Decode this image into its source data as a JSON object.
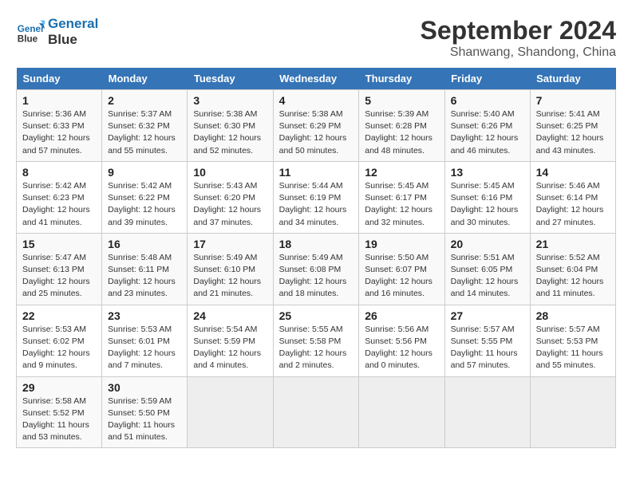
{
  "header": {
    "logo_line1": "General",
    "logo_line2": "Blue",
    "title": "September 2024",
    "subtitle": "Shanwang, Shandong, China"
  },
  "columns": [
    "Sunday",
    "Monday",
    "Tuesday",
    "Wednesday",
    "Thursday",
    "Friday",
    "Saturday"
  ],
  "weeks": [
    [
      {
        "day": "1",
        "info": "Sunrise: 5:36 AM\nSunset: 6:33 PM\nDaylight: 12 hours\nand 57 minutes."
      },
      {
        "day": "2",
        "info": "Sunrise: 5:37 AM\nSunset: 6:32 PM\nDaylight: 12 hours\nand 55 minutes."
      },
      {
        "day": "3",
        "info": "Sunrise: 5:38 AM\nSunset: 6:30 PM\nDaylight: 12 hours\nand 52 minutes."
      },
      {
        "day": "4",
        "info": "Sunrise: 5:38 AM\nSunset: 6:29 PM\nDaylight: 12 hours\nand 50 minutes."
      },
      {
        "day": "5",
        "info": "Sunrise: 5:39 AM\nSunset: 6:28 PM\nDaylight: 12 hours\nand 48 minutes."
      },
      {
        "day": "6",
        "info": "Sunrise: 5:40 AM\nSunset: 6:26 PM\nDaylight: 12 hours\nand 46 minutes."
      },
      {
        "day": "7",
        "info": "Sunrise: 5:41 AM\nSunset: 6:25 PM\nDaylight: 12 hours\nand 43 minutes."
      }
    ],
    [
      {
        "day": "8",
        "info": "Sunrise: 5:42 AM\nSunset: 6:23 PM\nDaylight: 12 hours\nand 41 minutes."
      },
      {
        "day": "9",
        "info": "Sunrise: 5:42 AM\nSunset: 6:22 PM\nDaylight: 12 hours\nand 39 minutes."
      },
      {
        "day": "10",
        "info": "Sunrise: 5:43 AM\nSunset: 6:20 PM\nDaylight: 12 hours\nand 37 minutes."
      },
      {
        "day": "11",
        "info": "Sunrise: 5:44 AM\nSunset: 6:19 PM\nDaylight: 12 hours\nand 34 minutes."
      },
      {
        "day": "12",
        "info": "Sunrise: 5:45 AM\nSunset: 6:17 PM\nDaylight: 12 hours\nand 32 minutes."
      },
      {
        "day": "13",
        "info": "Sunrise: 5:45 AM\nSunset: 6:16 PM\nDaylight: 12 hours\nand 30 minutes."
      },
      {
        "day": "14",
        "info": "Sunrise: 5:46 AM\nSunset: 6:14 PM\nDaylight: 12 hours\nand 27 minutes."
      }
    ],
    [
      {
        "day": "15",
        "info": "Sunrise: 5:47 AM\nSunset: 6:13 PM\nDaylight: 12 hours\nand 25 minutes."
      },
      {
        "day": "16",
        "info": "Sunrise: 5:48 AM\nSunset: 6:11 PM\nDaylight: 12 hours\nand 23 minutes."
      },
      {
        "day": "17",
        "info": "Sunrise: 5:49 AM\nSunset: 6:10 PM\nDaylight: 12 hours\nand 21 minutes."
      },
      {
        "day": "18",
        "info": "Sunrise: 5:49 AM\nSunset: 6:08 PM\nDaylight: 12 hours\nand 18 minutes."
      },
      {
        "day": "19",
        "info": "Sunrise: 5:50 AM\nSunset: 6:07 PM\nDaylight: 12 hours\nand 16 minutes."
      },
      {
        "day": "20",
        "info": "Sunrise: 5:51 AM\nSunset: 6:05 PM\nDaylight: 12 hours\nand 14 minutes."
      },
      {
        "day": "21",
        "info": "Sunrise: 5:52 AM\nSunset: 6:04 PM\nDaylight: 12 hours\nand 11 minutes."
      }
    ],
    [
      {
        "day": "22",
        "info": "Sunrise: 5:53 AM\nSunset: 6:02 PM\nDaylight: 12 hours\nand 9 minutes."
      },
      {
        "day": "23",
        "info": "Sunrise: 5:53 AM\nSunset: 6:01 PM\nDaylight: 12 hours\nand 7 minutes."
      },
      {
        "day": "24",
        "info": "Sunrise: 5:54 AM\nSunset: 5:59 PM\nDaylight: 12 hours\nand 4 minutes."
      },
      {
        "day": "25",
        "info": "Sunrise: 5:55 AM\nSunset: 5:58 PM\nDaylight: 12 hours\nand 2 minutes."
      },
      {
        "day": "26",
        "info": "Sunrise: 5:56 AM\nSunset: 5:56 PM\nDaylight: 12 hours\nand 0 minutes."
      },
      {
        "day": "27",
        "info": "Sunrise: 5:57 AM\nSunset: 5:55 PM\nDaylight: 11 hours\nand 57 minutes."
      },
      {
        "day": "28",
        "info": "Sunrise: 5:57 AM\nSunset: 5:53 PM\nDaylight: 11 hours\nand 55 minutes."
      }
    ],
    [
      {
        "day": "29",
        "info": "Sunrise: 5:58 AM\nSunset: 5:52 PM\nDaylight: 11 hours\nand 53 minutes."
      },
      {
        "day": "30",
        "info": "Sunrise: 5:59 AM\nSunset: 5:50 PM\nDaylight: 11 hours\nand 51 minutes."
      },
      {
        "day": "",
        "info": ""
      },
      {
        "day": "",
        "info": ""
      },
      {
        "day": "",
        "info": ""
      },
      {
        "day": "",
        "info": ""
      },
      {
        "day": "",
        "info": ""
      }
    ]
  ]
}
